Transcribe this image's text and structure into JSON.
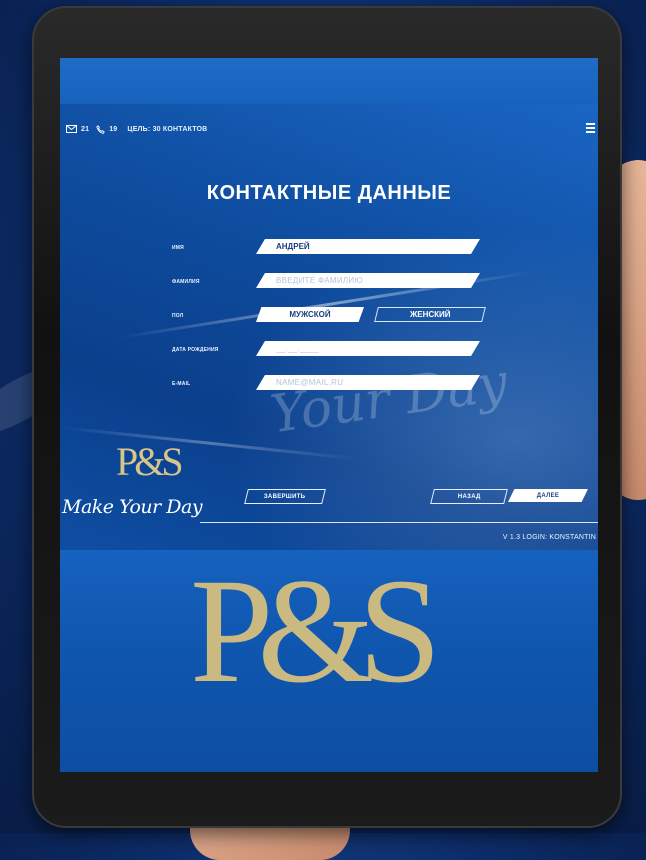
{
  "status": {
    "messages_count": "21",
    "calls_count": "19",
    "goal_text": "ЦЕЛЬ: 30 КОНТАКТОВ"
  },
  "page_title": "КОНТАКТНЫЕ ДАННЫЕ",
  "form": {
    "name_label": "ИМЯ",
    "name_value": "АНДРЕЙ",
    "surname_label": "ФАМИЛИЯ",
    "surname_placeholder": "ВВЕДИТЕ ФАМИЛИЮ",
    "gender_label": "ПОЛ",
    "gender_male": "МУЖСКОЙ",
    "gender_female": "ЖЕНСКИЙ",
    "birthdate_label": "ДАТА РОЖДЕНИЯ",
    "birthdate_placeholder": "__.__.____",
    "email_label": "E-MAIL",
    "email_placeholder": "NAME@MAIL.RU"
  },
  "buttons": {
    "finish": "ЗАВЕРШИТЬ",
    "back": "НАЗАД",
    "next": "ДАЛЕЕ"
  },
  "footer": {
    "version": "V 1.3 LOGIN: KONSTANTIN"
  },
  "branding": {
    "logo_text": "P&S",
    "tagline": "Make Your Day",
    "watermark": "Your Day"
  },
  "colors": {
    "accent": "#1259b4",
    "gold": "#d8c58a"
  }
}
